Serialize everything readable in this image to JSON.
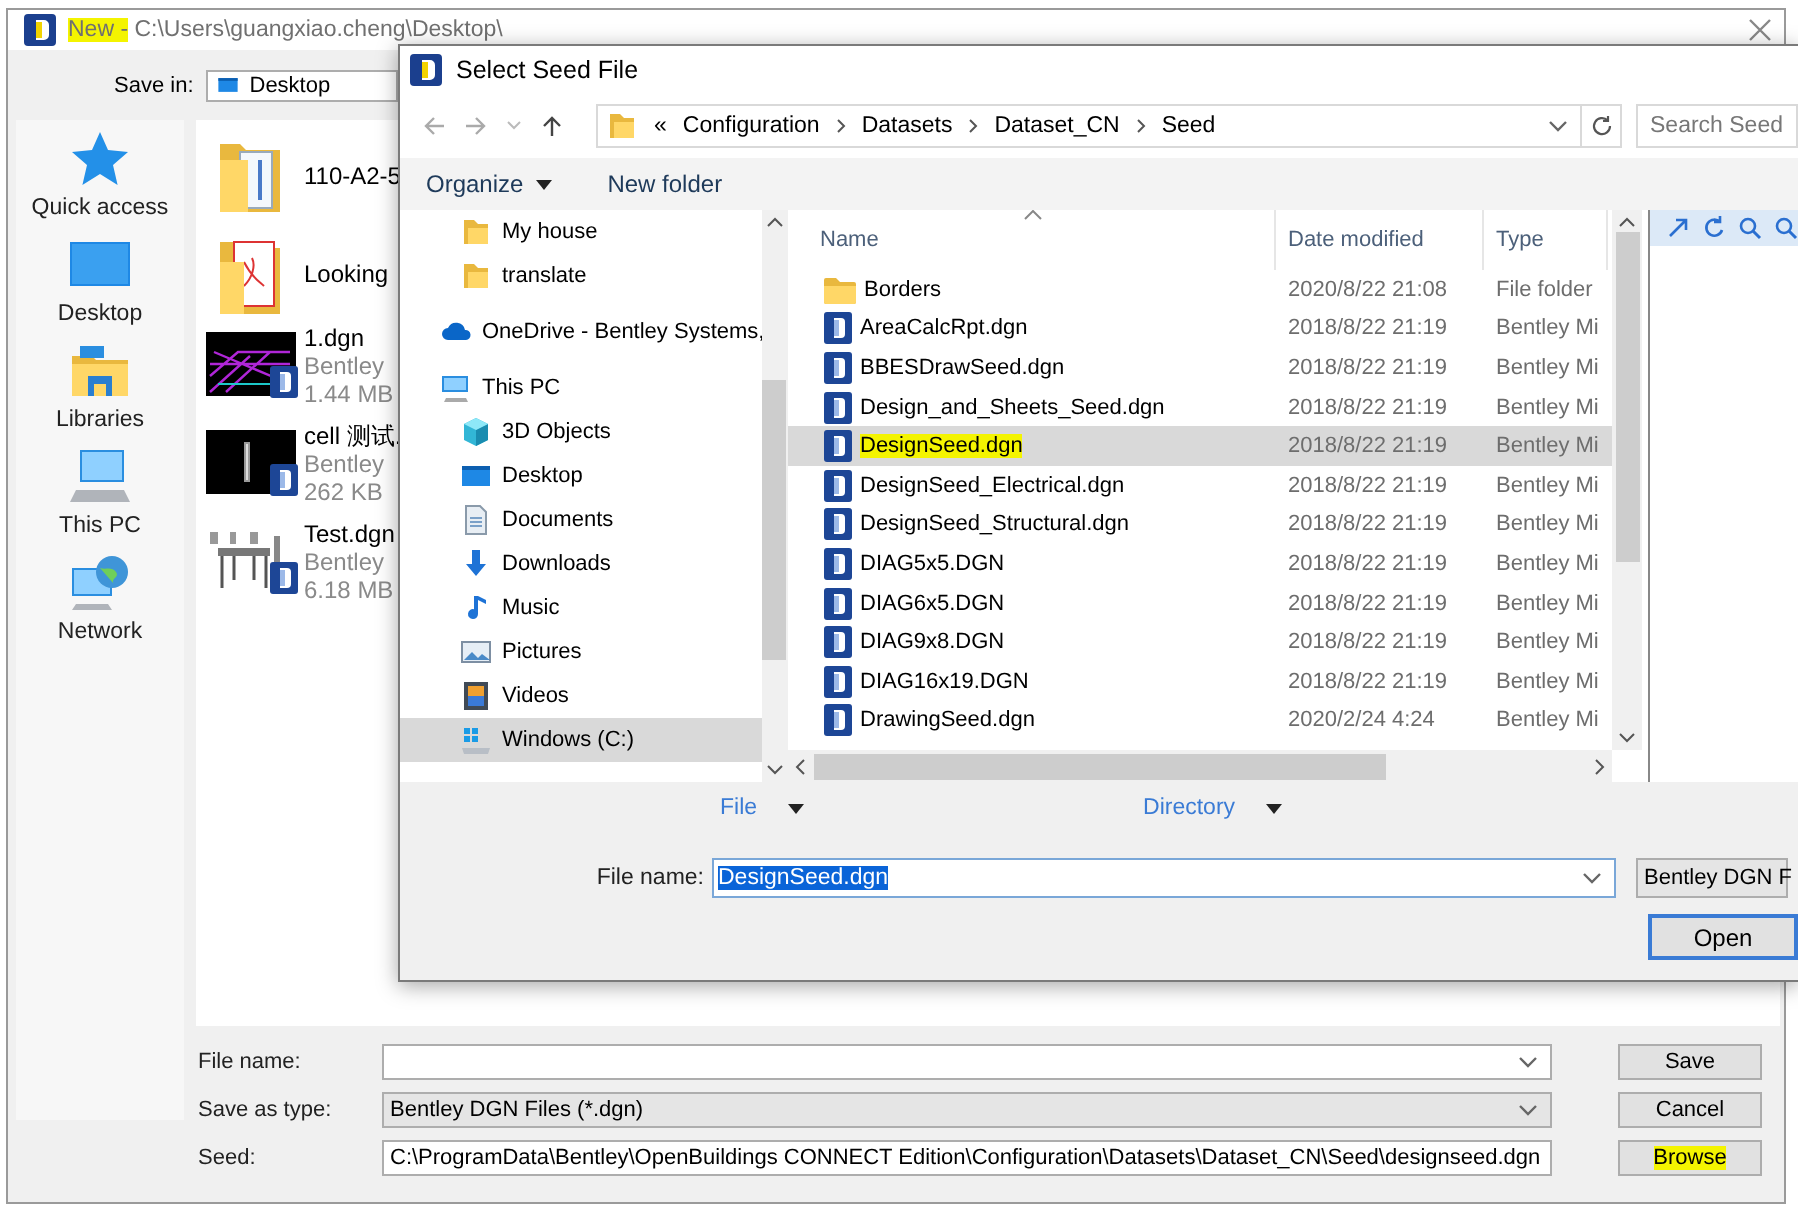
{
  "save_dialog": {
    "title": [
      {
        "text": "New -",
        "highlighted": true
      },
      {
        "text": " C:\\Users\\guangxiao.cheng\\Desktop\\",
        "highlighted": false
      }
    ],
    "save_in": {
      "label": "Save in:",
      "value": "Desktop"
    },
    "places": [
      {
        "label": "Quick access",
        "kind": "star"
      },
      {
        "label": "Desktop",
        "kind": "desktop"
      },
      {
        "label": "Libraries",
        "kind": "libraries"
      },
      {
        "label": "This PC",
        "kind": "pc"
      },
      {
        "label": "Network",
        "kind": "network"
      }
    ],
    "files": [
      {
        "name": "110-A2-5",
        "kind": "folder"
      },
      {
        "name": "Looking",
        "kind": "pdf-folder"
      },
      {
        "name": "1.dgn",
        "kind": "dgn",
        "type": "Bentley",
        "size": "1.44 MB"
      },
      {
        "name": "cell 测试.",
        "kind": "dgn",
        "type": "Bentley",
        "size": "262 KB"
      },
      {
        "name": "Test.dgn",
        "kind": "dgn",
        "type": "Bentley",
        "size": "6.18 MB"
      }
    ],
    "fields": [
      {
        "label": "File name:",
        "kind": "combo"
      },
      {
        "label": "Save as type:",
        "kind": "dropdown",
        "value": "Bentley DGN Files (*.dgn)"
      },
      {
        "label": "Seed:",
        "kind": "text",
        "value": "C:\\ProgramData\\Bentley\\OpenBuildings CONNECT Edition\\Configuration\\Datasets\\Dataset_CN\\Seed\\designseed.dgn"
      }
    ],
    "buttons": [
      {
        "label": "Save",
        "highlighted": false
      },
      {
        "label": "Cancel",
        "highlighted": false
      },
      {
        "label": "Browse",
        "highlighted": true
      }
    ]
  },
  "seed_dialog": {
    "title": "Select Seed File",
    "address": {
      "overflow": "«",
      "path": [
        "Configuration",
        "Datasets",
        "Dataset_CN",
        "Seed"
      ]
    },
    "search": {
      "placeholder": "Search Seed"
    },
    "toolbar": [
      {
        "label": "Organize",
        "dropdown": true
      },
      {
        "label": "New folder",
        "dropdown": false
      }
    ],
    "nav_pane": {
      "continued_items": [
        {
          "label": "My house",
          "kind": "folder",
          "selected": false
        },
        {
          "label": "translate",
          "kind": "folder",
          "selected": false
        }
      ],
      "items": [
        {
          "label": "OneDrive - Bentley Systems,",
          "kind": "cloud",
          "selected": false
        },
        {
          "label": "This PC",
          "kind": "pc",
          "selected": false,
          "children": [
            {
              "label": "3D Objects",
              "kind": "cube",
              "selected": false
            },
            {
              "label": "Desktop",
              "kind": "desktop",
              "selected": false
            },
            {
              "label": "Documents",
              "kind": "documents",
              "selected": false
            },
            {
              "label": "Downloads",
              "kind": "downloads",
              "selected": false
            },
            {
              "label": "Music",
              "kind": "music",
              "selected": false
            },
            {
              "label": "Pictures",
              "kind": "pictures",
              "selected": false
            },
            {
              "label": "Videos",
              "kind": "videos",
              "selected": false
            },
            {
              "label": "Windows (C:)",
              "kind": "drive",
              "selected": true
            }
          ]
        }
      ]
    },
    "columns": [
      {
        "label": "Name",
        "sorted": true
      },
      {
        "label": "Date modified",
        "sorted": false
      },
      {
        "label": "Type",
        "sorted": false
      }
    ],
    "rows": [
      {
        "name": "Borders",
        "kind": "folder",
        "date": "2020/8/22 21:08",
        "type": "File folder",
        "selected": false,
        "highlighted": false
      },
      {
        "name": "AreaCalcRpt.dgn",
        "kind": "dgn",
        "date": "2018/8/22 21:19",
        "type": "Bentley Mi",
        "selected": false,
        "highlighted": false
      },
      {
        "name": "BBESDrawSeed.dgn",
        "kind": "dgn",
        "date": "2018/8/22 21:19",
        "type": "Bentley Mi",
        "selected": false,
        "highlighted": false
      },
      {
        "name": "Design_and_Sheets_Seed.dgn",
        "kind": "dgn",
        "date": "2018/8/22 21:19",
        "type": "Bentley Mi",
        "selected": false,
        "highlighted": false
      },
      {
        "name": "DesignSeed.dgn",
        "kind": "dgn",
        "date": "2018/8/22 21:19",
        "type": "Bentley Mi",
        "selected": true,
        "highlighted": true
      },
      {
        "name": "DesignSeed_Electrical.dgn",
        "kind": "dgn",
        "date": "2018/8/22 21:19",
        "type": "Bentley Mi",
        "selected": false,
        "highlighted": false
      },
      {
        "name": "DesignSeed_Structural.dgn",
        "kind": "dgn",
        "date": "2018/8/22 21:19",
        "type": "Bentley Mi",
        "selected": false,
        "highlighted": false
      },
      {
        "name": "DIAG5x5.DGN",
        "kind": "dgn",
        "date": "2018/8/22 21:19",
        "type": "Bentley Mi",
        "selected": false,
        "highlighted": false
      },
      {
        "name": "DIAG6x5.DGN",
        "kind": "dgn",
        "date": "2018/8/22 21:19",
        "type": "Bentley Mi",
        "selected": false,
        "highlighted": false
      },
      {
        "name": "DIAG9x8.DGN",
        "kind": "dgn",
        "date": "2018/8/22 21:19",
        "type": "Bentley Mi",
        "selected": false,
        "highlighted": false
      },
      {
        "name": "DIAG16x19.DGN",
        "kind": "dgn",
        "date": "2018/8/22 21:19",
        "type": "Bentley Mi",
        "selected": false,
        "highlighted": false
      },
      {
        "name": "DrawingSeed.dgn",
        "kind": "dgn",
        "date": "2020/2/24 4:24",
        "type": "Bentley Mi",
        "selected": false,
        "highlighted": false
      }
    ],
    "view_options": [
      {
        "label": "File"
      },
      {
        "label": "Directory"
      }
    ],
    "file_name": {
      "label": "File name:",
      "value": "DesignSeed.dgn",
      "value_selected": true
    },
    "file_type": "Bentley DGN F",
    "open_button": "Open"
  }
}
